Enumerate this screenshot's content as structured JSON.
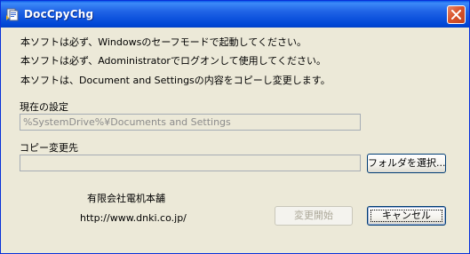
{
  "window": {
    "title": "DocCpyChg"
  },
  "messages": [
    "本ソフトは必ず、Windowsのセーフモードで起動してください。",
    "本ソフトは必ず、Adoministratorでログオンして使用してください。",
    "本ソフトは、Document and Settingsの内容をコピーし変更します。"
  ],
  "current_setting": {
    "label": "現在の設定",
    "value": "%SystemDrive%¥Documents and Settings"
  },
  "destination": {
    "label": "コピー変更先",
    "value": "",
    "browse_label": "フォルダを選択..."
  },
  "footer": {
    "company": "有限会社電机本舗",
    "url": "http://www.dnki.co.jp/"
  },
  "buttons": {
    "start_label": "変更開始",
    "cancel_label": "キャンセル"
  },
  "icons": {
    "app": "app-icon",
    "close": "close-icon"
  }
}
